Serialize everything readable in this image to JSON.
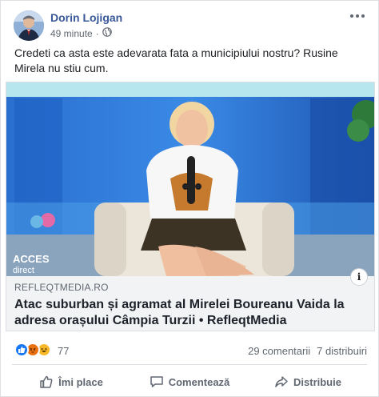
{
  "post": {
    "author": "Dorin Lojigan",
    "time": "49 minute",
    "separator": "·",
    "audience_icon": "globe-icon",
    "text": "Credeti ca asta este adevarata fata a municipiului nostru? Rusine Mirela nu stiu cum."
  },
  "link_preview": {
    "domain": "REFLEQTMEDIA.RO",
    "headline": "Atac suburban și agramat al Mirelei Boureanu Vaida la adresa orașului Câmpia Turzii • RefleqtMedia",
    "info_icon": "i",
    "watermark_line1": "ACCES",
    "watermark_line2": "direct"
  },
  "reactions": {
    "icons": [
      "like-icon",
      "angry-icon",
      "haha-icon"
    ],
    "count": "77",
    "comments": "29 comentarii",
    "shares": "7 distribuiri"
  },
  "actions": {
    "like": "Îmi place",
    "comment": "Comentează",
    "share": "Distribuie"
  },
  "colors": {
    "author_link": "#385898",
    "like_blue": "#1877f2",
    "angry_orange": "#e9710f",
    "haha_yellow": "#f7b928",
    "studio_blue": "#1f5fb8"
  }
}
